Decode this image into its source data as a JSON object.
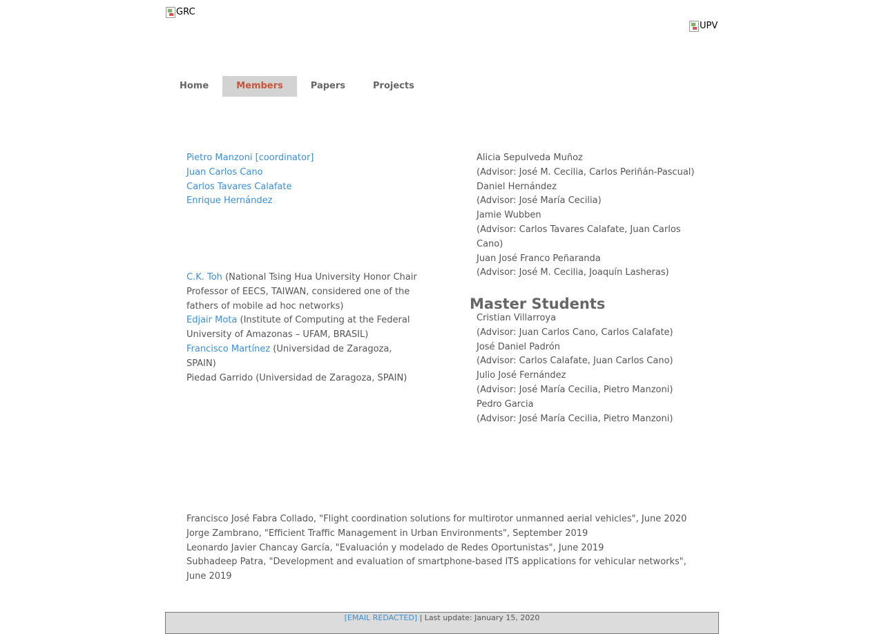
{
  "header": {
    "logo_left_alt": "GRC",
    "logo_right_alt": "UPV"
  },
  "nav": [
    {
      "label": "Home",
      "active": false
    },
    {
      "label": "Members",
      "active": true
    },
    {
      "label": "Papers",
      "active": false
    },
    {
      "label": "Projects",
      "active": false
    }
  ],
  "staff": [
    "Pietro Manzoni [coordinator]",
    "Juan Carlos Cano",
    "Carlos Tavares Calafate",
    "Enrique Hernández"
  ],
  "collaborators": {
    "ck_toh_name": "C.K. Toh",
    "ck_toh_desc": " (National Tsing Hua University Honor Chair Professor of EECS, TAIWAN, considered one of the fathers of mobile ad hoc networks)",
    "mota_name": "Edjair Mota",
    "mota_desc": " (Institute of Computing at the Federal University of Amazonas – UFAM, BRASIL)",
    "martinez_name": "Francisco Martínez",
    "martinez_desc": " (Universidad de Zaragoza, SPAIN)",
    "garrido": "Piedad Garrido (Universidad de Zaragoza, SPAIN)"
  },
  "phd_students": [
    {
      "name": "Alicia Sepulveda Muñoz",
      "advisor": "(Advisor: José M. Cecilia, Carlos Periñán-Pascual)"
    },
    {
      "name": "Daniel Hernández",
      "advisor": "(Advisor: José María Cecilia)"
    },
    {
      "name": "Jamie Wubben",
      "advisor": "(Advisor: Carlos Tavares Calafate, Juan Carlos Cano)"
    },
    {
      "name": "Juan José Franco Peñaranda",
      "advisor": "(Advisor: José M. Cecilia, Joaquín Lasheras)"
    }
  ],
  "master_title": "Master Students",
  "master_students": [
    {
      "name": "Cristian Villarroya",
      "advisor": "(Advisor: Juan Carlos Cano, Carlos Calafate)"
    },
    {
      "name": "José Daniel Padrón",
      "advisor": "(Advisor: Carlos Calafate, Juan Carlos Cano)"
    },
    {
      "name": "Julio José Fernández",
      "advisor": "(Advisor: José María Cecilia, Pietro Manzoni)"
    },
    {
      "name": "Pedro Garcia",
      "advisor": "(Advisor: José María Cecilia, Pietro Manzoni)"
    }
  ],
  "theses": [
    "Francisco José Fabra Collado, \"Flight coordination solutions for multirotor unmanned aerial vehicles\", June 2020",
    "Jorge Zambrano, \"Efficient Traffic Management in Urban Environments\", September 2019",
    "Leonardo Javier Chancay García, \"Evaluación y modelado de Redes Oportunistas\", June 2019",
    "Subhadeep Patra, \"Development and evaluation of smartphone-based ITS applications for vehicular networks\", June 2019"
  ],
  "footer": {
    "email": "[EMAIL REDACTED]",
    "update": " | Last update: January 15, 2020"
  }
}
